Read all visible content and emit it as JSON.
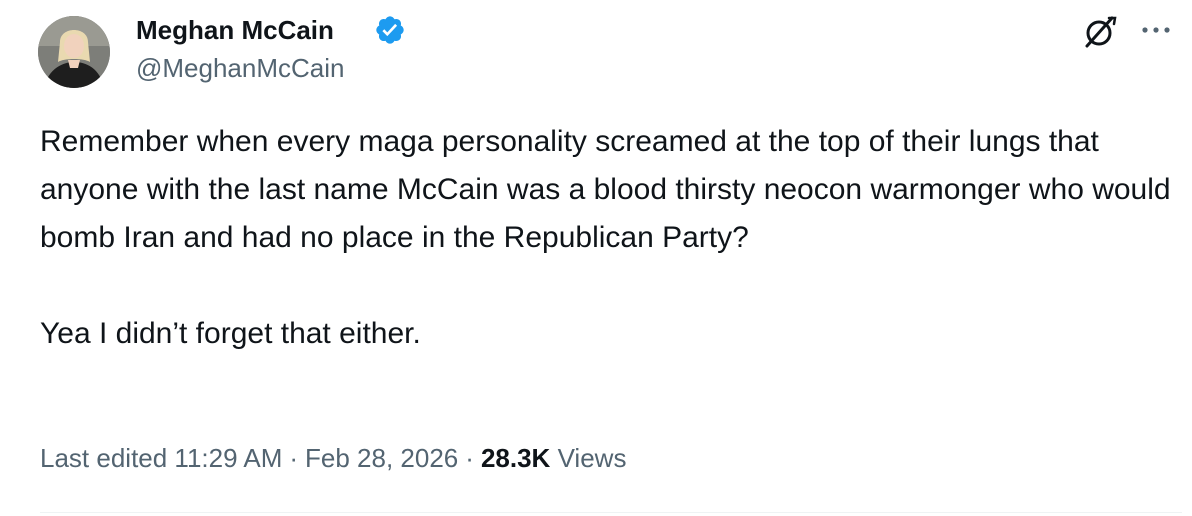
{
  "author": {
    "display_name": "Meghan McCain",
    "handle": "@MeghanMcCain",
    "verified": true,
    "verified_color": "#1d9bf0"
  },
  "actions": {
    "grok_icon": "grok-icon",
    "more_icon": "more-horizontal-icon"
  },
  "post": {
    "paragraphs": [
      "Remember when every maga personality screamed at the top of their lungs that anyone with the last name McCain was a blood thirsty neocon warmonger who would bomb Iran and had no place in the Republican Party?",
      "Yea I didn’t forget that either."
    ]
  },
  "meta": {
    "edited_label": "Last edited 11:29 AM",
    "separator": "·",
    "date": "Feb 28, 2026",
    "views_count": "28.3K",
    "views_label": "Views"
  },
  "colors": {
    "text_primary": "#0f1419",
    "text_secondary": "#536471",
    "divider": "#eff3f4"
  }
}
